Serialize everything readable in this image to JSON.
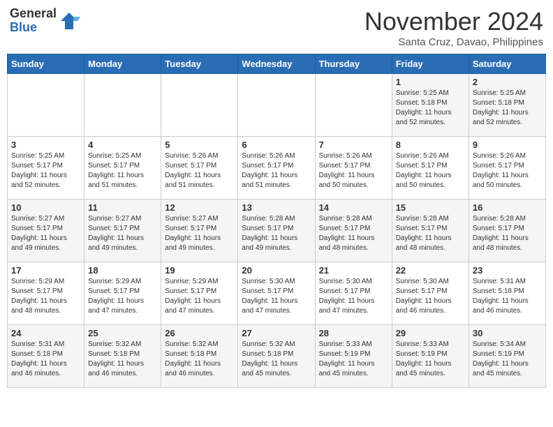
{
  "header": {
    "logo_general": "General",
    "logo_blue": "Blue",
    "title": "November 2024",
    "location": "Santa Cruz, Davao, Philippines"
  },
  "days_of_week": [
    "Sunday",
    "Monday",
    "Tuesday",
    "Wednesday",
    "Thursday",
    "Friday",
    "Saturday"
  ],
  "weeks": [
    [
      {
        "day": "",
        "info": ""
      },
      {
        "day": "",
        "info": ""
      },
      {
        "day": "",
        "info": ""
      },
      {
        "day": "",
        "info": ""
      },
      {
        "day": "",
        "info": ""
      },
      {
        "day": "1",
        "info": "Sunrise: 5:25 AM\nSunset: 5:18 PM\nDaylight: 11 hours\nand 52 minutes."
      },
      {
        "day": "2",
        "info": "Sunrise: 5:25 AM\nSunset: 5:18 PM\nDaylight: 11 hours\nand 52 minutes."
      }
    ],
    [
      {
        "day": "3",
        "info": "Sunrise: 5:25 AM\nSunset: 5:17 PM\nDaylight: 11 hours\nand 52 minutes."
      },
      {
        "day": "4",
        "info": "Sunrise: 5:25 AM\nSunset: 5:17 PM\nDaylight: 11 hours\nand 51 minutes."
      },
      {
        "day": "5",
        "info": "Sunrise: 5:26 AM\nSunset: 5:17 PM\nDaylight: 11 hours\nand 51 minutes."
      },
      {
        "day": "6",
        "info": "Sunrise: 5:26 AM\nSunset: 5:17 PM\nDaylight: 11 hours\nand 51 minutes."
      },
      {
        "day": "7",
        "info": "Sunrise: 5:26 AM\nSunset: 5:17 PM\nDaylight: 11 hours\nand 50 minutes."
      },
      {
        "day": "8",
        "info": "Sunrise: 5:26 AM\nSunset: 5:17 PM\nDaylight: 11 hours\nand 50 minutes."
      },
      {
        "day": "9",
        "info": "Sunrise: 5:26 AM\nSunset: 5:17 PM\nDaylight: 11 hours\nand 50 minutes."
      }
    ],
    [
      {
        "day": "10",
        "info": "Sunrise: 5:27 AM\nSunset: 5:17 PM\nDaylight: 11 hours\nand 49 minutes."
      },
      {
        "day": "11",
        "info": "Sunrise: 5:27 AM\nSunset: 5:17 PM\nDaylight: 11 hours\nand 49 minutes."
      },
      {
        "day": "12",
        "info": "Sunrise: 5:27 AM\nSunset: 5:17 PM\nDaylight: 11 hours\nand 49 minutes."
      },
      {
        "day": "13",
        "info": "Sunrise: 5:28 AM\nSunset: 5:17 PM\nDaylight: 11 hours\nand 49 minutes."
      },
      {
        "day": "14",
        "info": "Sunrise: 5:28 AM\nSunset: 5:17 PM\nDaylight: 11 hours\nand 48 minutes."
      },
      {
        "day": "15",
        "info": "Sunrise: 5:28 AM\nSunset: 5:17 PM\nDaylight: 11 hours\nand 48 minutes."
      },
      {
        "day": "16",
        "info": "Sunrise: 5:28 AM\nSunset: 5:17 PM\nDaylight: 11 hours\nand 48 minutes."
      }
    ],
    [
      {
        "day": "17",
        "info": "Sunrise: 5:29 AM\nSunset: 5:17 PM\nDaylight: 11 hours\nand 48 minutes."
      },
      {
        "day": "18",
        "info": "Sunrise: 5:29 AM\nSunset: 5:17 PM\nDaylight: 11 hours\nand 47 minutes."
      },
      {
        "day": "19",
        "info": "Sunrise: 5:29 AM\nSunset: 5:17 PM\nDaylight: 11 hours\nand 47 minutes."
      },
      {
        "day": "20",
        "info": "Sunrise: 5:30 AM\nSunset: 5:17 PM\nDaylight: 11 hours\nand 47 minutes."
      },
      {
        "day": "21",
        "info": "Sunrise: 5:30 AM\nSunset: 5:17 PM\nDaylight: 11 hours\nand 47 minutes."
      },
      {
        "day": "22",
        "info": "Sunrise: 5:30 AM\nSunset: 5:17 PM\nDaylight: 11 hours\nand 46 minutes."
      },
      {
        "day": "23",
        "info": "Sunrise: 5:31 AM\nSunset: 5:18 PM\nDaylight: 11 hours\nand 46 minutes."
      }
    ],
    [
      {
        "day": "24",
        "info": "Sunrise: 5:31 AM\nSunset: 5:18 PM\nDaylight: 11 hours\nand 46 minutes."
      },
      {
        "day": "25",
        "info": "Sunrise: 5:32 AM\nSunset: 5:18 PM\nDaylight: 11 hours\nand 46 minutes."
      },
      {
        "day": "26",
        "info": "Sunrise: 5:32 AM\nSunset: 5:18 PM\nDaylight: 11 hours\nand 46 minutes."
      },
      {
        "day": "27",
        "info": "Sunrise: 5:32 AM\nSunset: 5:18 PM\nDaylight: 11 hours\nand 45 minutes."
      },
      {
        "day": "28",
        "info": "Sunrise: 5:33 AM\nSunset: 5:19 PM\nDaylight: 11 hours\nand 45 minutes."
      },
      {
        "day": "29",
        "info": "Sunrise: 5:33 AM\nSunset: 5:19 PM\nDaylight: 11 hours\nand 45 minutes."
      },
      {
        "day": "30",
        "info": "Sunrise: 5:34 AM\nSunset: 5:19 PM\nDaylight: 11 hours\nand 45 minutes."
      }
    ]
  ]
}
